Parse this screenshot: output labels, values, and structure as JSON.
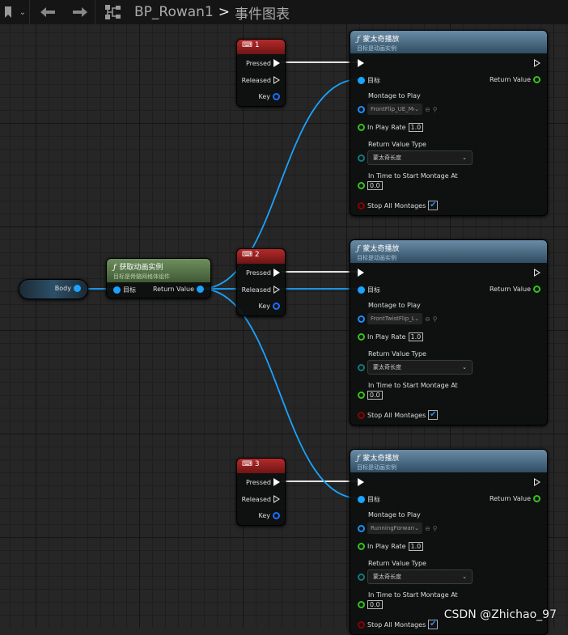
{
  "topbar": {
    "title": "BP_Rowan1",
    "separator": ">",
    "graph": "事件图表",
    "icons": [
      "bookmark-icon",
      "chevron-down-icon",
      "back-arrow-icon",
      "forward-arrow-icon",
      "blueprint-hierarchy-icon"
    ]
  },
  "body_node": {
    "label": "Body"
  },
  "get_anim": {
    "title": "获取动画实例",
    "subtitle": "目标是骨骼网格体组件",
    "target": "目标",
    "return": "Return Value"
  },
  "key_nodes": [
    {
      "key": "1",
      "pressed": "Pressed",
      "released": "Released",
      "key_label": "Key"
    },
    {
      "key": "2",
      "pressed": "Pressed",
      "released": "Released",
      "key_label": "Key"
    },
    {
      "key": "3",
      "pressed": "Pressed",
      "released": "Released",
      "key_label": "Key"
    }
  ],
  "montage_nodes": [
    {
      "title": "蒙太奇播放",
      "subtitle": "目标是动画实例",
      "target": "目标",
      "return": "Return Value",
      "montage_label": "Montage to Play",
      "montage": "FrontFlip_UE_Mc",
      "rate_label": "In Play Rate",
      "rate": "1.0",
      "rvt_label": "Return Value Type",
      "rvt": "蒙太奇长度",
      "time_label": "In Time to Start Montage At",
      "time": "0.0",
      "stop_label": "Stop All Montages",
      "stop_checked": true
    },
    {
      "title": "蒙太奇播放",
      "subtitle": "目标是动画实例",
      "target": "目标",
      "return": "Return Value",
      "montage_label": "Montage to Play",
      "montage": "FrontTwistFlip_L",
      "rate_label": "In Play Rate",
      "rate": "1.0",
      "rvt_label": "Return Value Type",
      "rvt": "蒙太奇长度",
      "time_label": "In Time to Start Montage At",
      "time": "0.0",
      "stop_label": "Stop All Montages",
      "stop_checked": true
    },
    {
      "title": "蒙太奇播放",
      "subtitle": "目标是动画实例",
      "target": "目标",
      "return": "Return Value",
      "montage_label": "Montage to Play",
      "montage": "RunningForward",
      "rate_label": "In Play Rate",
      "rate": "1.0",
      "rvt_label": "Return Value Type",
      "rvt": "蒙太奇长度",
      "time_label": "In Time to Start Montage At",
      "time": "0.0",
      "stop_label": "Stop All Montages",
      "stop_checked": true
    }
  ],
  "watermark": "CSDN @Zhichao_97",
  "colors": {
    "wire_object": "#1aa3ff",
    "wire_exec": "#ffffff",
    "key_header": "#8b1a1a",
    "function_header": "#4b6e86",
    "pure_header": "#5a7a4a",
    "float_pin": "#34c41a",
    "bool_pin": "#8b0000"
  }
}
